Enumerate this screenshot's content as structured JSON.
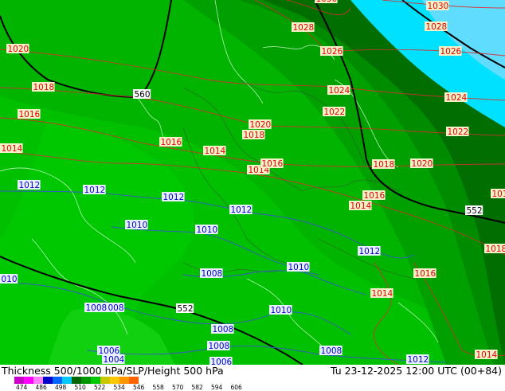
{
  "footer": {
    "title": "Thickness 500/1000 hPa/SLP/Height 500 hPa",
    "datetime": "Tu 23-12-2025 12:00 UTC (00+84)"
  },
  "legend": {
    "ticks": [
      "474",
      "486",
      "498",
      "510",
      "522",
      "534",
      "546",
      "558",
      "570",
      "582",
      "594",
      "606"
    ],
    "colors": [
      "#c800c8",
      "#ff00ff",
      "#ff7cff",
      "#0000c8",
      "#0064ff",
      "#00c8ff",
      "#006400",
      "#009600",
      "#00c800",
      "#c8c800",
      "#ffc800",
      "#ff9600",
      "#ff6400"
    ]
  },
  "isobar_labels_red": [
    {
      "text": "1030",
      "color": "#e00000"
    },
    {
      "text": "1030",
      "color": "#e00000"
    },
    {
      "text": "1028",
      "color": "#e00000"
    },
    {
      "text": "1028",
      "color": "#e00000"
    },
    {
      "text": "1026",
      "color": "#e00000"
    },
    {
      "text": "1026",
      "color": "#e00000"
    },
    {
      "text": "1020",
      "color": "#e00000"
    },
    {
      "text": "1018",
      "color": "#e00000"
    },
    {
      "text": "1024",
      "color": "#e00000"
    },
    {
      "text": "1024",
      "color": "#e00000"
    },
    {
      "text": "1022",
      "color": "#e00000"
    },
    {
      "text": "1022",
      "color": "#e00000"
    },
    {
      "text": "1016",
      "color": "#e00000"
    },
    {
      "text": "1020",
      "color": "#e00000"
    },
    {
      "text": "1018",
      "color": "#e00000"
    },
    {
      "text": "1016",
      "color": "#e00000"
    },
    {
      "text": "1014",
      "color": "#e00000"
    },
    {
      "text": "1014",
      "color": "#e00000"
    },
    {
      "text": "1014",
      "color": "#e00000"
    },
    {
      "text": "1016",
      "color": "#e00000"
    },
    {
      "text": "1018",
      "color": "#e00000"
    },
    {
      "text": "1020",
      "color": "#e00000"
    },
    {
      "text": "1016",
      "color": "#e00000"
    },
    {
      "text": "1014",
      "color": "#e00000"
    },
    {
      "text": "101",
      "color": "#e00000"
    },
    {
      "text": "1018",
      "color": "#e00000"
    },
    {
      "text": "1016",
      "color": "#e00000"
    },
    {
      "text": "1014",
      "color": "#e00000"
    },
    {
      "text": "1014",
      "color": "#e00000"
    }
  ],
  "isobar_labels_blue": [
    {
      "text": "1012",
      "color": "#0000c8"
    },
    {
      "text": "1012",
      "color": "#0000c8"
    },
    {
      "text": "1012",
      "color": "#0000c8"
    },
    {
      "text": "1012",
      "color": "#0000c8"
    },
    {
      "text": "1010",
      "color": "#0000c8"
    },
    {
      "text": "1010",
      "color": "#0000c8"
    },
    {
      "text": "1012",
      "color": "#0000c8"
    },
    {
      "text": "1008",
      "color": "#0000c8"
    },
    {
      "text": "1010",
      "color": "#0000c8"
    },
    {
      "text": "010",
      "color": "#0000c8"
    },
    {
      "text": "1008",
      "color": "#0000c8"
    },
    {
      "text": "008",
      "color": "#0000c8"
    },
    {
      "text": "1010",
      "color": "#0000c8"
    },
    {
      "text": "1008",
      "color": "#0000c8"
    },
    {
      "text": "1008",
      "color": "#0000c8"
    },
    {
      "text": "1008",
      "color": "#0000c8"
    },
    {
      "text": "1006",
      "color": "#0000c8"
    },
    {
      "text": "1004",
      "color": "#0000c8"
    },
    {
      "text": "1006",
      "color": "#0000c8"
    },
    {
      "text": "1012",
      "color": "#0000c8"
    }
  ],
  "height_labels": [
    "560",
    "552",
    "552"
  ]
}
